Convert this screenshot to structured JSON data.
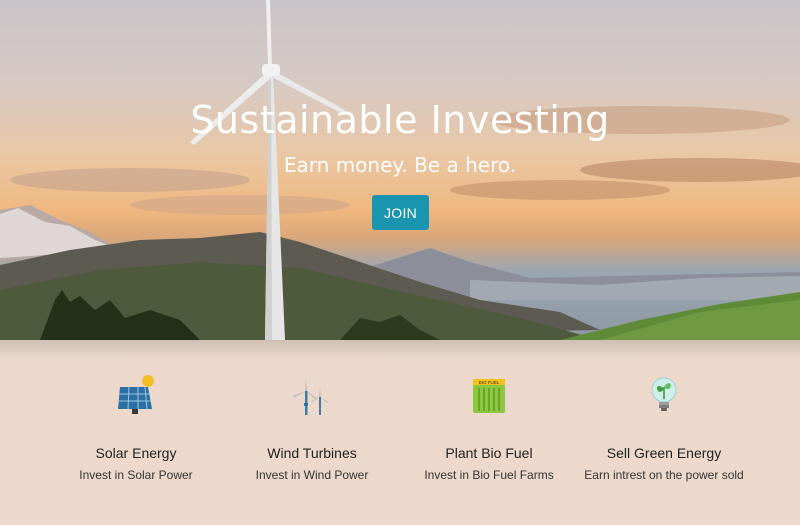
{
  "hero": {
    "title": "Sustainable Investing",
    "subtitle": "Earn money. Be a hero.",
    "cta_label": "JOIN"
  },
  "features": [
    {
      "icon": "solar-panel-icon",
      "title": "Solar Energy",
      "description": "Invest in Solar Power"
    },
    {
      "icon": "wind-turbine-icon",
      "title": "Wind Turbines",
      "description": "Invest in Wind Power"
    },
    {
      "icon": "bio-fuel-icon",
      "title": "Plant Bio Fuel",
      "description": "Invest in Bio Fuel Farms",
      "icon_text": "BIO FUEL"
    },
    {
      "icon": "eco-bulb-icon",
      "title": "Sell Green Energy",
      "description": "Earn intrest on the power sold"
    }
  ],
  "colors": {
    "accent": "#1a95b0",
    "features_bg": "#ecd9cb"
  }
}
